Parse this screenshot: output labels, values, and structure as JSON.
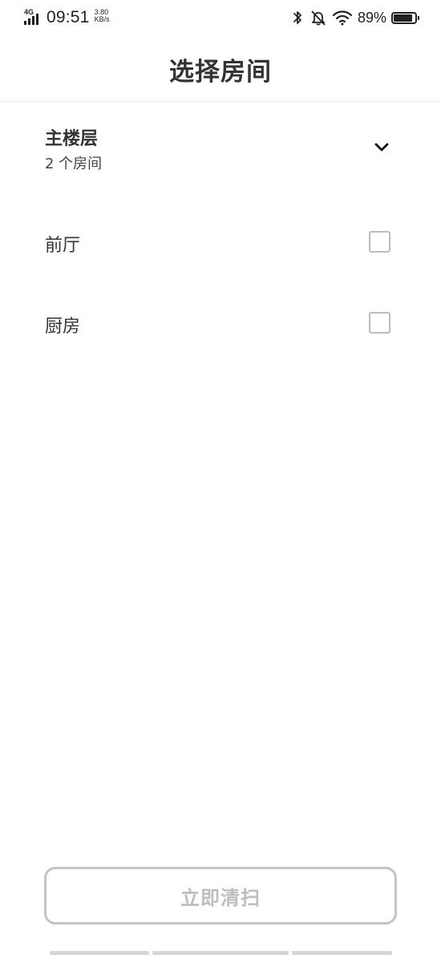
{
  "status_bar": {
    "network": "4G",
    "time": "09:51",
    "speed_value": "3.80",
    "speed_unit": "KB/s",
    "battery_percent": "89%",
    "battery_level": 0.89,
    "icons": [
      "signal-icon",
      "bluetooth-icon",
      "mute-bell-icon",
      "wifi-icon",
      "battery-icon"
    ]
  },
  "header": {
    "title": "选择房间"
  },
  "floor": {
    "name": "主楼层",
    "room_count": "2 个房间",
    "expand_icon": "chevron-down-icon"
  },
  "rooms": [
    {
      "label": "前厅",
      "checked": false
    },
    {
      "label": "厨房",
      "checked": false
    }
  ],
  "actions": {
    "clean_now_label": "立即清扫",
    "clean_now_enabled": false
  },
  "colors": {
    "text": "#333333",
    "checkbox_border": "#bdbdbd",
    "disabled_button_border": "#c4c4c4",
    "disabled_button_text": "#bdbdbd",
    "background": "#ffffff"
  }
}
